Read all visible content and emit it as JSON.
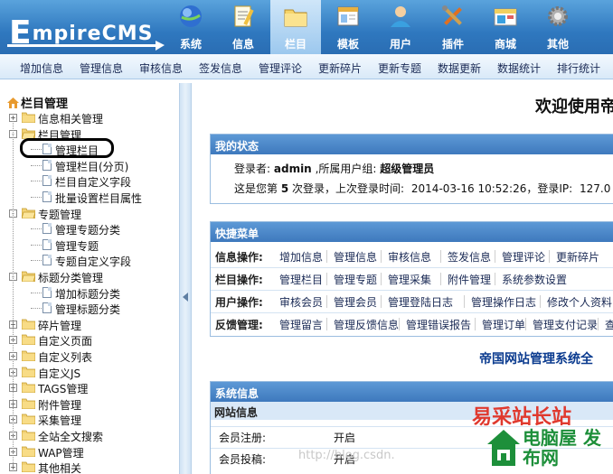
{
  "logo": {
    "text_big": "E",
    "text_rest": "mpireCMS"
  },
  "top_menu": [
    {
      "label": "系统",
      "icon": "globe-icon",
      "color": "#2f6fd0"
    },
    {
      "label": "信息",
      "icon": "notepad-icon",
      "color": "#f0c040"
    },
    {
      "label": "栏目",
      "icon": "folder-icon",
      "color": "#f5d46a",
      "active": true
    },
    {
      "label": "模板",
      "icon": "window-icon",
      "color": "#e8b040"
    },
    {
      "label": "用户",
      "icon": "user-icon",
      "color": "#3aa0e0"
    },
    {
      "label": "插件",
      "icon": "tools-icon",
      "color": "#e07020"
    },
    {
      "label": "商城",
      "icon": "shop-icon",
      "color": "#f0d060"
    },
    {
      "label": "其他",
      "icon": "gear-icon",
      "color": "#b0b0b0"
    }
  ],
  "sub_nav": [
    "增加信息",
    "管理信息",
    "审核信息",
    "签发信息",
    "管理评论",
    "更新碎片",
    "更新专题",
    "数据更新",
    "数据统计",
    "排行统计"
  ],
  "tree": {
    "root": "栏目管理",
    "rows": [
      {
        "label": "信息相关管理",
        "type": "folder",
        "pm": "+"
      },
      {
        "label": "栏目管理",
        "type": "folder-open",
        "pm": "-"
      },
      {
        "label": "管理栏目",
        "type": "page"
      },
      {
        "label": "管理栏目(分页)",
        "type": "page"
      },
      {
        "label": "栏目自定义字段",
        "type": "page"
      },
      {
        "label": "批量设置栏目属性",
        "type": "page"
      },
      {
        "label": "专题管理",
        "type": "folder-open",
        "pm": "-"
      },
      {
        "label": "管理专题分类",
        "type": "page"
      },
      {
        "label": "管理专题",
        "type": "page"
      },
      {
        "label": "专题自定义字段",
        "type": "page"
      },
      {
        "label": "标题分类管理",
        "type": "folder-open",
        "pm": "-"
      },
      {
        "label": "增加标题分类",
        "type": "page"
      },
      {
        "label": "管理标题分类",
        "type": "page"
      },
      {
        "label": "碎片管理",
        "type": "folder",
        "pm": "+"
      },
      {
        "label": "自定义页面",
        "type": "folder",
        "pm": "+"
      },
      {
        "label": "自定义列表",
        "type": "folder",
        "pm": "+"
      },
      {
        "label": "自定义JS",
        "type": "folder",
        "pm": "+"
      },
      {
        "label": "TAGS管理",
        "type": "folder",
        "pm": "+"
      },
      {
        "label": "附件管理",
        "type": "folder",
        "pm": "+"
      },
      {
        "label": "采集管理",
        "type": "folder",
        "pm": "+"
      },
      {
        "label": "全站全文搜索",
        "type": "folder",
        "pm": "+"
      },
      {
        "label": "WAP管理",
        "type": "folder",
        "pm": "+"
      },
      {
        "label": "其他相关",
        "type": "folder",
        "pm": "+"
      }
    ]
  },
  "main": {
    "welcome": "欢迎使用帝",
    "status": {
      "title": "我的状态",
      "login_label": "登录者:",
      "login_user": "admin",
      "group_label": ",所属用户组:",
      "group": "超级管理员",
      "visit_prefix": "这是您第",
      "visit_count": "5",
      "visit_mid": "次登录，上次登录时间:",
      "last_time": "2014-03-16 10:52:26",
      "ip_label": "，登录IP:",
      "ip": "127.0"
    },
    "quick": {
      "title": "快捷菜单",
      "rows": [
        {
          "category": "信息操作:",
          "links": [
            "增加信息",
            "管理信息",
            "审核信息",
            "签发信息",
            "管理评论",
            "更新碎片"
          ]
        },
        {
          "category": "栏目操作:",
          "links": [
            "管理栏目",
            "管理专题",
            "管理采集",
            "附件管理",
            "系统参数设置"
          ]
        },
        {
          "category": "用户操作:",
          "links": [
            "审核会员",
            "管理会员",
            "管理登陆日志",
            "管理操作日志",
            "修改个人资料"
          ]
        },
        {
          "category": "反馈管理:",
          "links": [
            "管理留言",
            "管理反馈信息",
            "管理错误报告",
            "管理订单",
            "管理支付记录",
            "查"
          ]
        }
      ]
    },
    "blue_title": "帝国网站管理系统全",
    "sysinfo": {
      "title": "系统信息",
      "subtitle": "网站信息",
      "rows": [
        {
          "label": "会员注册:",
          "value": "开启"
        },
        {
          "label": "会员投稿:",
          "value": "开启"
        }
      ]
    }
  },
  "watermark": {
    "url": "http://blog.csdn.",
    "red": "易采站长站",
    "green": "电脑屋 发布网"
  }
}
